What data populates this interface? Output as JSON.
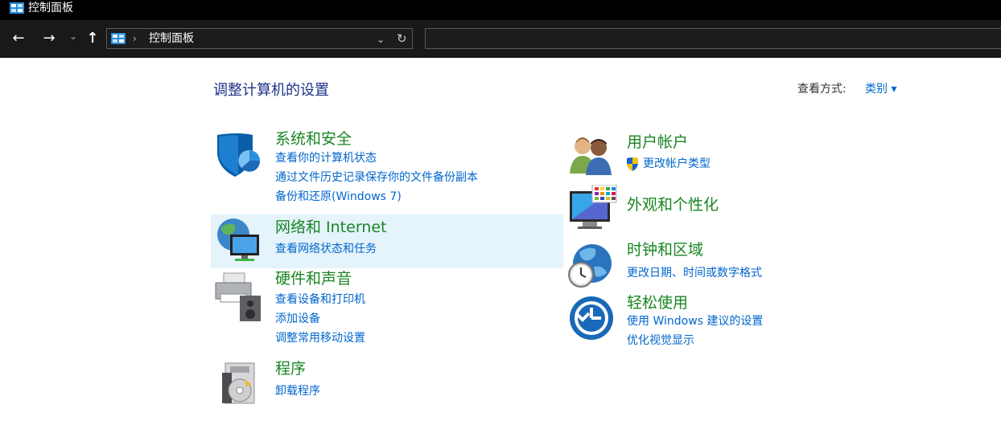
{
  "window": {
    "title": "控制面板"
  },
  "address": {
    "crumb": "控制面板",
    "separator": "›"
  },
  "icons": {
    "back": "arrow-left-icon",
    "forward": "arrow-right-icon",
    "recent": "chevron-down-icon",
    "up": "arrow-up-icon",
    "refresh": "refresh-icon"
  },
  "glyphs": {
    "back": "←",
    "forward": "→",
    "recent": "⌄",
    "up": "↑",
    "dropdown": "⌄",
    "refresh": "↻"
  },
  "main": {
    "heading": "调整计算机的设置",
    "view_by_label": "查看方式:",
    "view_by_value": "类别 ▾"
  },
  "categories": {
    "system_security": {
      "title": "系统和安全",
      "links": [
        "查看你的计算机状态",
        "通过文件历史记录保存你的文件备份副本",
        "备份和还原(Windows 7)"
      ]
    },
    "network": {
      "title": "网络和 Internet",
      "links": [
        "查看网络状态和任务"
      ]
    },
    "hardware": {
      "title": "硬件和声音",
      "links": [
        "查看设备和打印机",
        "添加设备",
        "调整常用移动设置"
      ]
    },
    "programs": {
      "title": "程序",
      "links": [
        "卸载程序"
      ]
    },
    "user_accounts": {
      "title": "用户帐户",
      "links": [
        "更改帐户类型"
      ]
    },
    "appearance": {
      "title": "外观和个性化",
      "links": []
    },
    "clock_region": {
      "title": "时钟和区域",
      "links": [
        "更改日期、时间或数字格式"
      ]
    },
    "ease_of_access": {
      "title": "轻松使用",
      "links": [
        "使用 Windows 建议的设置",
        "优化视觉显示"
      ]
    }
  },
  "colors": {
    "title_green": "#1a8524",
    "link_blue": "#0066cc",
    "heading_blue": "#1e3287",
    "hover_bg": "#e5f3fb",
    "toolbar_bg": "#191919"
  }
}
